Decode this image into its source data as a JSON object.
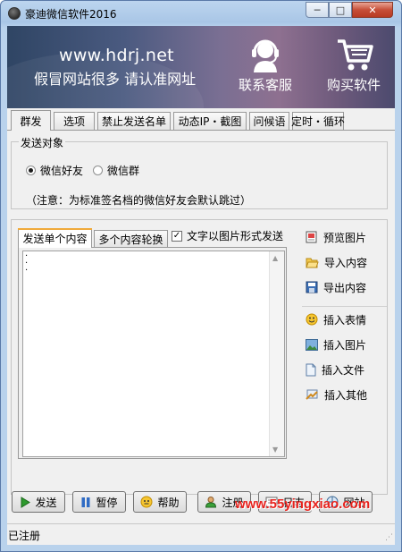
{
  "window": {
    "title": "豪迪微信软件2016",
    "min_label": "─",
    "max_label": "□",
    "close_label": "✕"
  },
  "banner": {
    "url": "www.hdrj.net",
    "slogan": "假冒网站很多 请认准网址",
    "service_label": "联系客服",
    "buy_label": "购买软件"
  },
  "tabs": [
    "群发",
    "选项",
    "禁止发送名单",
    "动态IP・截图",
    "问候语",
    "定时・循环"
  ],
  "send_target": {
    "title": "发送对象",
    "options": [
      {
        "label": "微信好友",
        "selected": true
      },
      {
        "label": "微信群",
        "selected": false
      }
    ],
    "notice": "（注意：为标准签名档的微信好友会默认跳过）"
  },
  "content": {
    "subtabs": [
      "发送单个内容",
      "多个内容轮换"
    ],
    "image_mode_label": "文字以图片形式发送",
    "image_mode_checked": true,
    "check_mark": "✓",
    "editor_lines": [
      "·",
      "·",
      "·"
    ],
    "scroll_up": "▲",
    "scroll_down": "▼"
  },
  "side_actions": [
    "预览图片",
    "导入内容",
    "导出内容",
    "插入表情",
    "插入图片",
    "插入文件",
    "插入其他"
  ],
  "bottom_buttons": [
    "发送",
    "暂停",
    "帮助",
    "注册",
    "日志",
    "网站"
  ],
  "status": {
    "text": "已注册",
    "grip": "⋰"
  },
  "watermark": "www.55yingxiao.com",
  "colors": {
    "watermark": "#e8231e",
    "close_button": "#c74f38",
    "subtab_accent": "#f0a93a"
  }
}
